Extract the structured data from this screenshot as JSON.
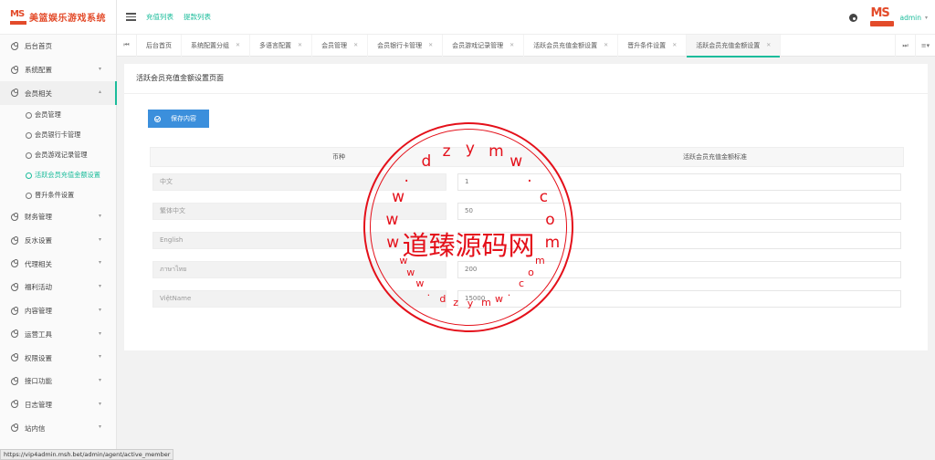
{
  "brand": {
    "title": "美篮娱乐游戏系统",
    "logo_text": "MS"
  },
  "header": {
    "links": [
      "充值列表",
      "提款列表"
    ],
    "user": "admin",
    "avatar_text": "MS"
  },
  "sidebar": {
    "items": [
      {
        "label": "后台首页",
        "chevron": false
      },
      {
        "label": "系统配置",
        "chevron": true
      },
      {
        "label": "会员相关",
        "chevron": true,
        "open": true,
        "children": [
          "会员管理",
          "会员银行卡管理",
          "会员游戏记录管理",
          "活跃会员充值金额设置",
          "晋升条件设置"
        ]
      },
      {
        "label": "财务管理",
        "chevron": true
      },
      {
        "label": "反水设置",
        "chevron": true
      },
      {
        "label": "代理相关",
        "chevron": true
      },
      {
        "label": "福利活动",
        "chevron": true
      },
      {
        "label": "内容管理",
        "chevron": true
      },
      {
        "label": "运营工具",
        "chevron": true
      },
      {
        "label": "权限设置",
        "chevron": true
      },
      {
        "label": "接口功能",
        "chevron": true
      },
      {
        "label": "日志管理",
        "chevron": true
      },
      {
        "label": "站内信",
        "chevron": true
      }
    ],
    "active_child": "活跃会员充值金额设置"
  },
  "tabs": [
    {
      "label": "后台首页",
      "closable": false
    },
    {
      "label": "系统配置分组",
      "closable": true
    },
    {
      "label": "多语言配置",
      "closable": true
    },
    {
      "label": "会员管理",
      "closable": true
    },
    {
      "label": "会员银行卡管理",
      "closable": true
    },
    {
      "label": "会员游戏记录管理",
      "closable": true
    },
    {
      "label": "活跃会员充值金额设置",
      "closable": true
    },
    {
      "label": "晋升条件设置",
      "closable": true
    },
    {
      "label": "活跃会员充值金额设置",
      "closable": true,
      "active": true
    }
  ],
  "main": {
    "page_title": "活跃会员充值金额设置页面",
    "save_label": "保存内容",
    "table": {
      "columns": [
        "币种",
        "活跃会员充值金额标准"
      ],
      "rows": [
        {
          "currency": "中文",
          "value": "1"
        },
        {
          "currency": "繁体中文",
          "value": "50"
        },
        {
          "currency": "English",
          "value": ""
        },
        {
          "currency": "ภาษาไทย",
          "value": "200"
        },
        {
          "currency": "ViệtName",
          "value": "15000"
        }
      ]
    }
  },
  "watermark": {
    "center": "道臻源码网",
    "ring_text": "www.dzymw.com"
  },
  "status_url": "https://vip4admin.msh.bet/admin/agent/active_member",
  "colors": {
    "accent": "#1bbc9b",
    "primary_button": "#3b8fdc",
    "brand": "#e34b2a",
    "stamp": "#e4101a"
  }
}
